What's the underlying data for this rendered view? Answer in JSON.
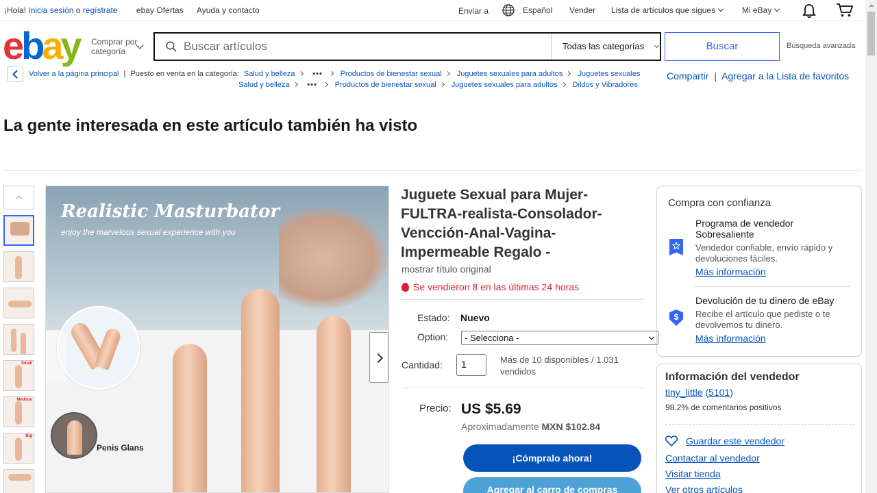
{
  "topbar": {
    "greeting": "¡Hola!",
    "signin": "Inicia sesión",
    "or": "o",
    "register": "regístrate",
    "deals": "ebay Ofertas",
    "help": "Ayuda y contacto",
    "ship_to": "Enviar a",
    "language": "Español",
    "sell": "Vender",
    "watchlist": "Lista de artículos que sigues",
    "my_ebay": "Mi eBay"
  },
  "header": {
    "logo": {
      "e": "e",
      "b": "b",
      "a": "a",
      "y": "y"
    },
    "shop_by_category_1": "Comprar por",
    "shop_by_category_2": "categoría",
    "search_placeholder": "Buscar artículos",
    "category_select": "Todas las categorías",
    "search_button": "Buscar",
    "advanced": "Búsqueda avanzada"
  },
  "breadcrumb": {
    "back": "Volver a la página principal",
    "listed_in": "Puesto en venta en la categoría:",
    "path1": [
      "Salud y belleza",
      "Productos de bienestar sexual",
      "Juguetes sexuales para adultos",
      "Juguetes sexuales"
    ],
    "path2": [
      "Salud y belleza",
      "Productos de bienestar sexual",
      "Juguetes sexuales para adultos",
      "Dildos y Vibradores"
    ],
    "ellipsis": "•••",
    "share": "Compartir",
    "pipe": "|",
    "add_watchlist": "Agregar a la Lista de favoritos"
  },
  "also_viewed_heading": "La gente interesada en este artículo también ha visto",
  "image": {
    "overlay_title": "Realistic Masturbator",
    "overlay_subtitle": "enjoy the marvelous sexual experience with you",
    "glans_label": "Penis Glans",
    "thumb_tags": [
      "",
      "",
      "",
      "",
      "Small",
      "Medium",
      "Big",
      ""
    ]
  },
  "product": {
    "title": "Juguete Sexual para Mujer-FULTRA-realista-Consolador-Vencción-Anal-Vagina-Impermeable Regalo -",
    "show_original": "mostrar título original",
    "sold_recent": "Se vendieron 8 en las últimas 24 horas",
    "condition_label": "Estado:",
    "condition_value": "Nuevo",
    "option_label": "Option:",
    "option_value": "- Selecciona -",
    "quantity_label": "Cantidad:",
    "quantity_value": "1",
    "availability": "Más de 10 disponibles / 1.031 vendidos",
    "price_label": "Precio:",
    "price": "US $5.69",
    "approx_prefix": "Aproximadamente",
    "approx_value": "MXN $102.84",
    "buy_now": "¡Cómpralo ahora!",
    "add_to_cart": "Agregar al carro de compras"
  },
  "trust": {
    "heading": "Compra con confianza",
    "seller_program_title": "Programa de vendedor Sobresaliente",
    "seller_program_desc": "Vendedor confiable, envío rápido y devoluciones fáciles.",
    "more_info_1": "Más información",
    "money_back_title": "Devolución de tu dinero de eBay",
    "money_back_desc": "Recibe el artículo que pediste o te devolvemos tu dinero.",
    "more_info_2": "Más información",
    "shield_symbol": "$"
  },
  "seller": {
    "heading": "Información del vendedor",
    "name": "tiny_little",
    "feedback_count": "5101",
    "feedback_open": "(",
    "feedback_close": ")",
    "positive": "98.2% de comentarios positivos",
    "save_seller": "Guardar este vendedor",
    "contact": "Contactar al vendedor",
    "store": "Visitar tienda",
    "other_items": "Ver otros artículos"
  },
  "colors": {
    "link": "#0654ba",
    "primary_button": "#0654ba",
    "secondary_button": "#4ca1d7",
    "urgency": "#dd1e31"
  }
}
